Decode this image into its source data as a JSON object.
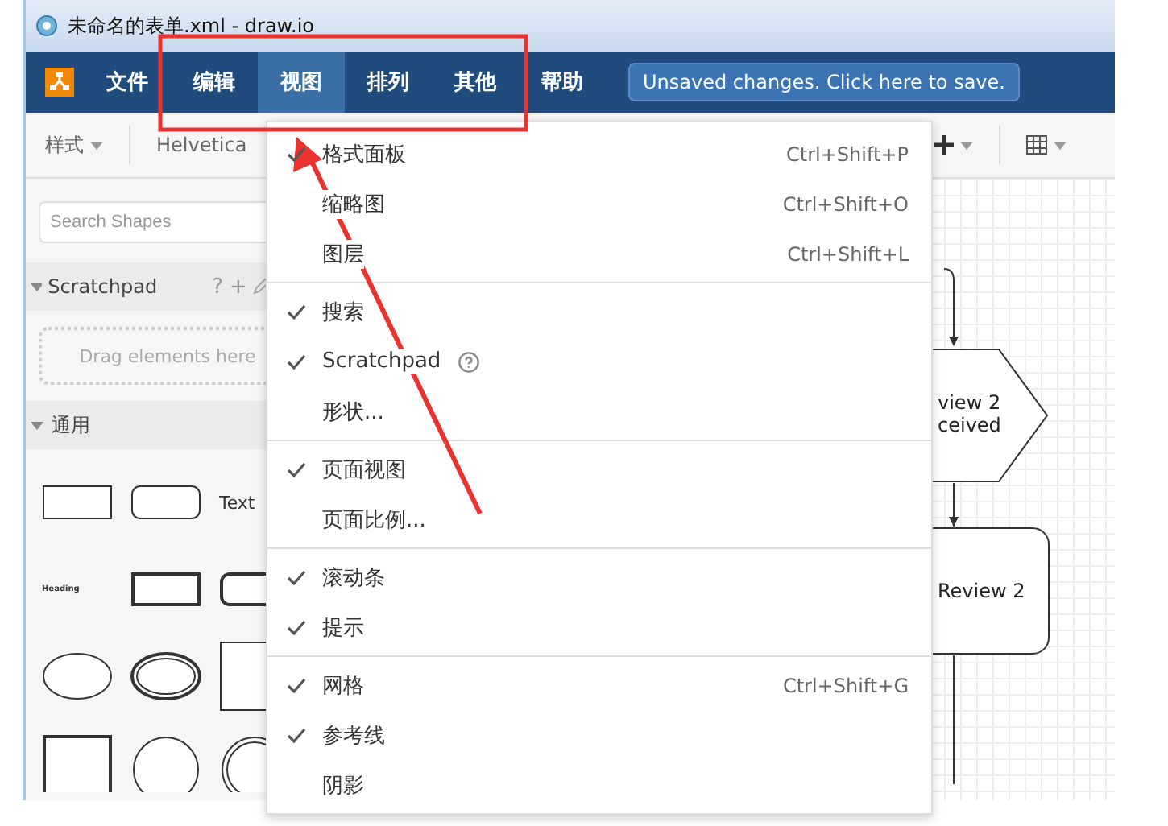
{
  "window": {
    "title": "未命名的表单.xml - draw.io"
  },
  "menubar": {
    "items": [
      {
        "label": "文件",
        "selected": false
      },
      {
        "label": "编辑",
        "selected": false
      },
      {
        "label": "视图",
        "selected": true
      },
      {
        "label": "排列",
        "selected": false
      },
      {
        "label": "其他",
        "selected": false
      },
      {
        "label": "帮助",
        "selected": false
      }
    ],
    "save_notice": "Unsaved changes. Click here to save."
  },
  "toolbar": {
    "style_label": "样式",
    "font": "Helvetica"
  },
  "sidebar": {
    "search": {
      "placeholder": "Search Shapes"
    },
    "sections": [
      {
        "kind": "scratchpad",
        "title": "Scratchpad",
        "expanded": true,
        "actions": [
          "?",
          "+"
        ],
        "drop_hint": "Drag elements here"
      },
      {
        "kind": "shapes",
        "title": "通用",
        "expanded": true,
        "shapes": [
          {
            "kind": "rect"
          },
          {
            "kind": "rounded"
          },
          {
            "kind": "text",
            "label": "Text"
          },
          {
            "kind": "heading",
            "label": "Heading"
          },
          {
            "kind": "rect-thick"
          },
          {
            "kind": "rounded-thick"
          },
          {
            "kind": "ellipse"
          },
          {
            "kind": "ellipse-double"
          },
          {
            "kind": "square"
          },
          {
            "kind": "square-thick"
          },
          {
            "kind": "circle"
          },
          {
            "kind": "circle-double"
          }
        ]
      }
    ]
  },
  "menu": {
    "groups": [
      {
        "items": [
          {
            "label": "格式面板",
            "checked": true,
            "shortcut": "Ctrl+Shift+P"
          },
          {
            "label": "缩略图",
            "checked": false,
            "shortcut": "Ctrl+Shift+O"
          },
          {
            "label": "图层",
            "checked": false,
            "shortcut": "Ctrl+Shift+L"
          }
        ]
      },
      {
        "items": [
          {
            "label": "搜索",
            "checked": true
          },
          {
            "label": "Scratchpad",
            "checked": true,
            "help": true
          },
          {
            "label": "形状...",
            "checked": false
          }
        ]
      },
      {
        "items": [
          {
            "label": "页面视图",
            "checked": true
          },
          {
            "label": "页面比例...",
            "checked": false
          }
        ]
      },
      {
        "items": [
          {
            "label": "滚动条",
            "checked": true
          },
          {
            "label": "提示",
            "checked": true
          }
        ]
      },
      {
        "items": [
          {
            "label": "网格",
            "checked": true,
            "shortcut": "Ctrl+Shift+G"
          },
          {
            "label": "参考线",
            "checked": true
          },
          {
            "label": "阴影",
            "checked": false
          }
        ]
      }
    ]
  },
  "canvas": {
    "shapes": [
      {
        "kind": "hexagon",
        "lines": [
          "view 2",
          "ceived"
        ]
      },
      {
        "kind": "rounded",
        "lines": [
          "Review 2"
        ]
      }
    ]
  }
}
